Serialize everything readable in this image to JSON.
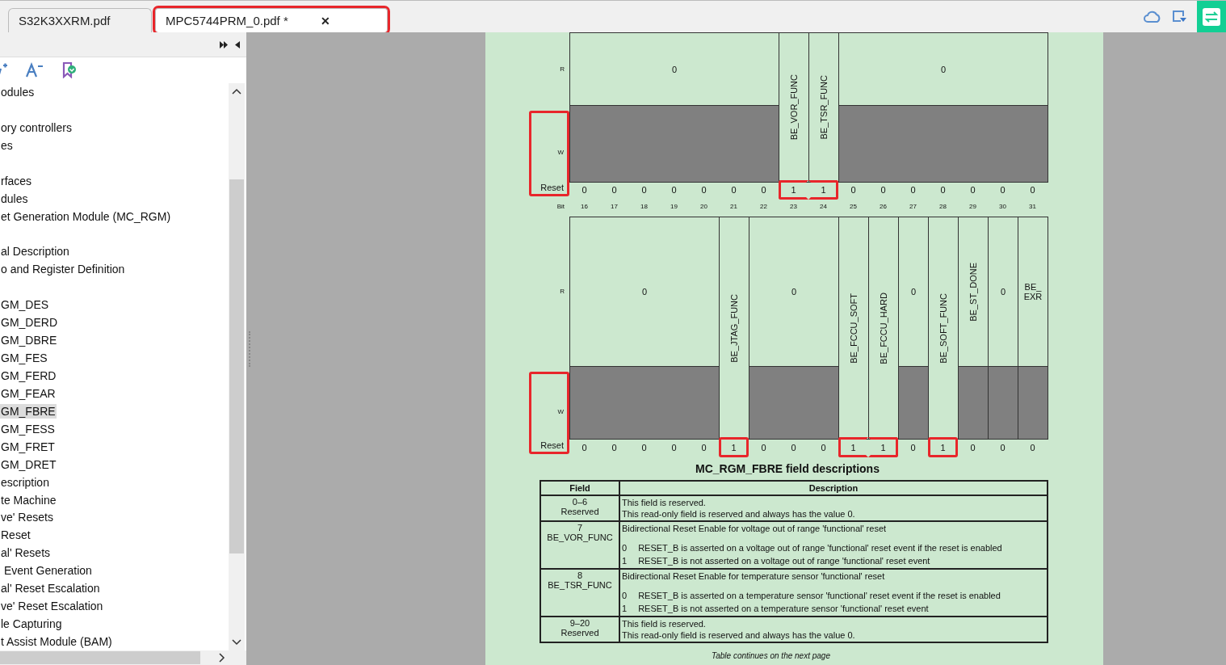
{
  "tabs": [
    {
      "label": "S32K3XXRM.pdf",
      "selected": false,
      "highlighted": false
    },
    {
      "label": "MPC5744PRM_0.pdf *",
      "selected": true,
      "highlighted": true,
      "close": "✕"
    }
  ],
  "sidebar": {
    "items": [
      {
        "kind": "text",
        "label": "odules",
        "selected": false
      },
      {
        "kind": "spacer"
      },
      {
        "kind": "text",
        "label": "ory controllers",
        "selected": false
      },
      {
        "kind": "text",
        "label": "es",
        "selected": false
      },
      {
        "kind": "spacer"
      },
      {
        "kind": "text",
        "label": "rfaces",
        "selected": false
      },
      {
        "kind": "text",
        "label": "dules",
        "selected": false
      },
      {
        "kind": "text",
        "label": "et Generation Module (MC_RGM)",
        "selected": false
      },
      {
        "kind": "spacer"
      },
      {
        "kind": "text",
        "label": "al Description",
        "selected": false
      },
      {
        "kind": "text",
        "label": "o and Register Definition",
        "selected": false
      },
      {
        "kind": "spacer"
      },
      {
        "kind": "text",
        "label": "GM_DES",
        "selected": false
      },
      {
        "kind": "text",
        "label": "GM_DERD",
        "selected": false
      },
      {
        "kind": "text",
        "label": "GM_DBRE",
        "selected": false
      },
      {
        "kind": "text",
        "label": "GM_FES",
        "selected": false
      },
      {
        "kind": "text",
        "label": "GM_FERD",
        "selected": false
      },
      {
        "kind": "text",
        "label": "GM_FEAR",
        "selected": false
      },
      {
        "kind": "text",
        "label": "GM_FBRE",
        "selected": true
      },
      {
        "kind": "text",
        "label": "GM_FESS",
        "selected": false
      },
      {
        "kind": "text",
        "label": "GM_FRET",
        "selected": false
      },
      {
        "kind": "text",
        "label": "GM_DRET",
        "selected": false
      },
      {
        "kind": "text",
        "label": "escription",
        "selected": false
      },
      {
        "kind": "text",
        "label": "te Machine",
        "selected": false
      },
      {
        "kind": "text",
        "label": "ve' Resets",
        "selected": false
      },
      {
        "kind": "text",
        "label": "Reset",
        "selected": false
      },
      {
        "kind": "text",
        "label": "al' Resets",
        "selected": false
      },
      {
        "kind": "text",
        "label": " Event Generation",
        "selected": false
      },
      {
        "kind": "text",
        "label": "al' Reset Escalation",
        "selected": false
      },
      {
        "kind": "text",
        "label": "ve' Reset Escalation",
        "selected": false
      },
      {
        "kind": "text",
        "label": "le Capturing",
        "selected": false
      },
      {
        "kind": "text",
        "label": "t Assist Module (BAM)",
        "selected": false
      }
    ]
  },
  "registers": [
    {
      "row_labels": [
        "R",
        "W",
        "Reset"
      ],
      "label_highlighted": true,
      "fields": [
        {
          "name": "0",
          "writable": false,
          "vertical": false,
          "reset": [
            {
              "value": "0",
              "highlighted": false
            },
            {
              "value": "0",
              "highlighted": false
            },
            {
              "value": "0",
              "highlighted": false
            },
            {
              "value": "0",
              "highlighted": false
            },
            {
              "value": "0",
              "highlighted": false
            },
            {
              "value": "0",
              "highlighted": false
            },
            {
              "value": "0",
              "highlighted": false
            }
          ]
        },
        {
          "name": "BE_VOR_FUNC",
          "writable": true,
          "vertical": true,
          "reset": [
            {
              "value": "1",
              "highlighted": true
            }
          ]
        },
        {
          "name": "BE_TSR_FUNC",
          "writable": true,
          "vertical": true,
          "reset": [
            {
              "value": "1",
              "highlighted": true
            }
          ]
        },
        {
          "name": "0",
          "writable": false,
          "vertical": false,
          "reset": [
            {
              "value": "0",
              "highlighted": false
            },
            {
              "value": "0",
              "highlighted": false
            },
            {
              "value": "0",
              "highlighted": false
            },
            {
              "value": "0",
              "highlighted": false
            },
            {
              "value": "0",
              "highlighted": false
            },
            {
              "value": "0",
              "highlighted": false
            },
            {
              "value": "0",
              "highlighted": false
            }
          ]
        }
      ]
    },
    {
      "bit_label": "Bit",
      "bits": [
        "16",
        "17",
        "18",
        "19",
        "20",
        "21",
        "22",
        "23",
        "24",
        "25",
        "26",
        "27",
        "28",
        "29",
        "30",
        "31"
      ],
      "row_labels": [
        "R",
        "W",
        "Reset"
      ],
      "label_highlighted": true,
      "fields": [
        {
          "name": "0",
          "writable": false,
          "vertical": false,
          "reset": [
            {
              "value": "0",
              "highlighted": false
            },
            {
              "value": "0",
              "highlighted": false
            },
            {
              "value": "0",
              "highlighted": false
            },
            {
              "value": "0",
              "highlighted": false
            },
            {
              "value": "0",
              "highlighted": false
            }
          ]
        },
        {
          "name": "BE_JTAG_FUNC",
          "writable": true,
          "vertical": true,
          "reset": [
            {
              "value": "1",
              "highlighted": true
            }
          ]
        },
        {
          "name": "0",
          "writable": false,
          "vertical": false,
          "reset": [
            {
              "value": "0",
              "highlighted": false
            },
            {
              "value": "0",
              "highlighted": false
            },
            {
              "value": "0",
              "highlighted": false
            }
          ]
        },
        {
          "name": "BE_FCCU_SOFT",
          "writable": true,
          "vertical": true,
          "reset": [
            {
              "value": "1",
              "highlighted": true
            }
          ]
        },
        {
          "name": "BE_FCCU_HARD",
          "writable": true,
          "vertical": true,
          "reset": [
            {
              "value": "1",
              "highlighted": true
            }
          ]
        },
        {
          "name": "0",
          "writable": false,
          "vertical": false,
          "reset": [
            {
              "value": "0",
              "highlighted": false
            }
          ]
        },
        {
          "name": "BE_SOFT_FUNC",
          "writable": true,
          "vertical": true,
          "reset": [
            {
              "value": "1",
              "highlighted": true
            }
          ]
        },
        {
          "name": "BE_ST_DONE",
          "writable": false,
          "vertical": true,
          "reset": [
            {
              "value": "0",
              "highlighted": false
            }
          ]
        },
        {
          "name": "0",
          "writable": false,
          "vertical": false,
          "reset": [
            {
              "value": "0",
              "highlighted": false
            }
          ]
        },
        {
          "name": "BE_EXR",
          "writable": false,
          "vertical": false,
          "reset": [
            {
              "value": "0",
              "highlighted": false
            }
          ]
        }
      ]
    }
  ],
  "field_table": {
    "title": "MC_RGM_FBRE field descriptions",
    "columns": [
      "Field",
      "Description"
    ],
    "rows": [
      {
        "bits": "0–6",
        "name": "Reserved",
        "description": [
          "This field is reserved.",
          "This read-only field is reserved and always has the value 0."
        ]
      },
      {
        "bits": "7",
        "name": "BE_VOR_FUNC",
        "description": [
          "Bidirectional Reset Enable for voltage out of range 'functional' reset"
        ],
        "values": [
          {
            "value": "0",
            "text": "RESET_B is asserted on a voltage out of range 'functional' reset event if the reset is enabled"
          },
          {
            "value": "1",
            "text": "RESET_B is not asserted on a voltage out of range 'functional' reset event"
          }
        ]
      },
      {
        "bits": "8",
        "name": "BE_TSR_FUNC",
        "description": [
          "Bidirectional Reset Enable for temperature sensor 'functional' reset"
        ],
        "values": [
          {
            "value": "0",
            "text": "RESET_B is asserted on a temperature sensor 'functional' reset event if the reset is enabled"
          },
          {
            "value": "1",
            "text": "RESET_B is not asserted on a temperature sensor 'functional' reset event"
          }
        ]
      },
      {
        "bits": "9–20",
        "name": "Reserved",
        "description": [
          "This field is reserved.",
          "This read-only field is reserved and always has the value 0."
        ]
      }
    ],
    "footer": "Table continues on the next page"
  }
}
